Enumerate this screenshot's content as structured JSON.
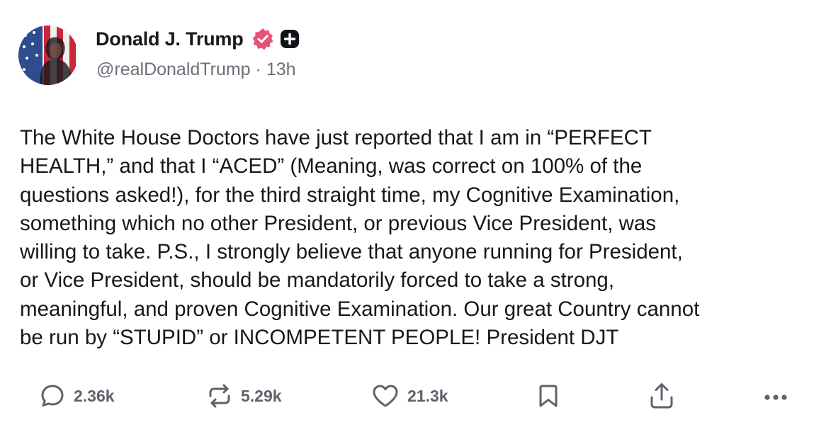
{
  "author": {
    "display_name": "Donald J. Trump",
    "handle": "@realDonaldTrump",
    "separator": "·",
    "time_ago": "13h",
    "verified": true,
    "verified_color": "#e5537a",
    "plus_badge": "plus-icon"
  },
  "post": {
    "lines": [
      "The White House Doctors have just reported that I am in “PERFECT",
      "HEALTH,” and that I “ACED” (Meaning, was correct on 100% of the",
      "questions asked!), for the third straight time, my Cognitive Examination,",
      "something which no other President, or previous Vice President, was",
      "willing to take. P.S., I strongly believe that anyone running for President,",
      "or Vice President, should be mandatorily forced to take a strong,",
      "meaningful, and proven Cognitive Examination. Our great Country cannot",
      "be run by “STUPID” or INCOMPETENT PEOPLE! President DJT"
    ]
  },
  "actions": {
    "reply": {
      "icon": "reply-icon",
      "count": "2.36k"
    },
    "repost": {
      "icon": "repost-icon",
      "count": "5.29k"
    },
    "like": {
      "icon": "heart-icon",
      "count": "21.3k"
    },
    "bookmark": {
      "icon": "bookmark-icon"
    },
    "share": {
      "icon": "share-icon"
    },
    "more": {
      "icon": "more-icon"
    }
  },
  "colors": {
    "text": "#17181c",
    "muted": "#6b6f78",
    "icon": "#5e626b"
  }
}
